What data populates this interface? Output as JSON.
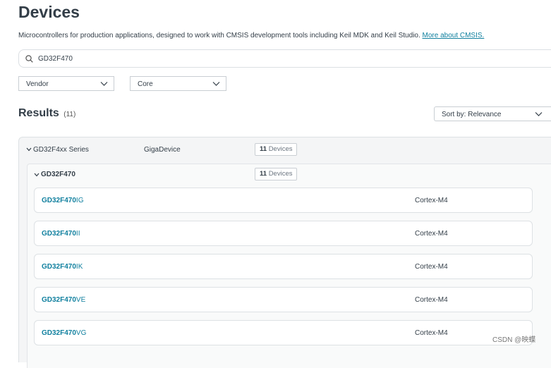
{
  "page": {
    "title": "Devices",
    "description": "Microcontrollers for production applications, designed to work with CMSIS development tools including Keil MDK and Keil Studio.",
    "description_link": "More about CMSIS."
  },
  "search": {
    "value": "GD32F470",
    "icon": "search-icon"
  },
  "filters": {
    "vendor_label": "Vendor",
    "core_label": "Core"
  },
  "results": {
    "heading": "Results",
    "count": "(11)",
    "sort_label": "Sort by: Relevance"
  },
  "series": {
    "name": "GD32F4xx Series",
    "vendor": "GigaDevice",
    "badge_count": "11",
    "badge_text": "Devices",
    "family": {
      "name": "GD32F470",
      "badge_count": "11",
      "badge_text": "Devices"
    }
  },
  "devices": [
    {
      "prefix": "GD32F470",
      "suffix": "IG",
      "core": "Cortex-M4"
    },
    {
      "prefix": "GD32F470",
      "suffix": "II",
      "core": "Cortex-M4"
    },
    {
      "prefix": "GD32F470",
      "suffix": "IK",
      "core": "Cortex-M4"
    },
    {
      "prefix": "GD32F470",
      "suffix": "VE",
      "core": "Cortex-M4"
    },
    {
      "prefix": "GD32F470",
      "suffix": "VG",
      "core": "Cortex-M4"
    }
  ],
  "watermark": "CSDN @映蝶",
  "colors": {
    "accent": "#11809f",
    "text": "#333e48",
    "panel": "#f4f5f6"
  }
}
